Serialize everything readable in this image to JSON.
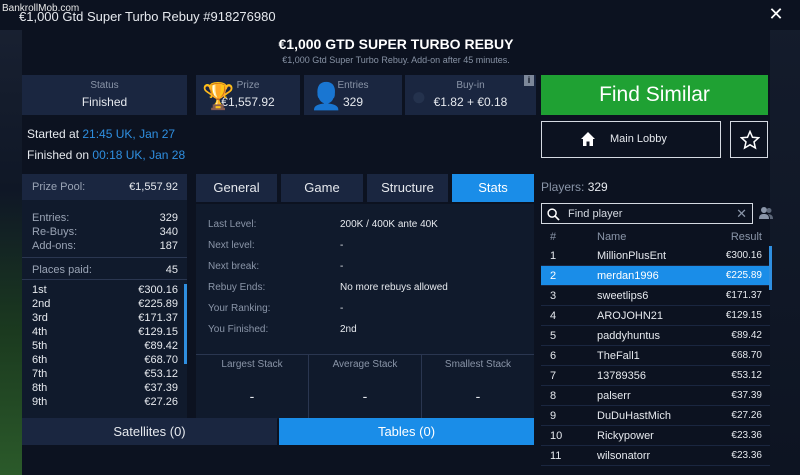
{
  "watermark": "BankrollMob.com",
  "window": {
    "title": "€1,000 Gtd Super Turbo Rebuy #918276980"
  },
  "header": {
    "title": "€1,000 GTD SUPER TURBO REBUY",
    "subtitle": "€1,000 Gtd Super Turbo Rebuy. Add-on after 45 minutes."
  },
  "info": {
    "status_label": "Status",
    "status_value": "Finished",
    "prize_label": "Prize",
    "prize_value": "€1,557.92",
    "entries_label": "Entries",
    "entries_value": "329",
    "buyin_label": "Buy-in",
    "buyin_value": "€1.82 + €0.18",
    "info_icon": "i"
  },
  "times": {
    "started_prefix": "Started at",
    "started_value": "21:45 UK, Jan 27",
    "finished_prefix": "Finished on",
    "finished_value": "00:18 UK, Jan 28"
  },
  "actions": {
    "find_similar": "Find Similar",
    "main_lobby": "Main Lobby"
  },
  "prize_panel": {
    "pool_label": "Prize Pool:",
    "pool_value": "€1,557.92",
    "entries_label": "Entries:",
    "entries_value": "329",
    "rebuys_label": "Re-Buys:",
    "rebuys_value": "340",
    "addons_label": "Add-ons:",
    "addons_value": "187",
    "places_label": "Places paid:",
    "places_value": "45",
    "places": [
      {
        "place": "1st",
        "amount": "€300.16"
      },
      {
        "place": "2nd",
        "amount": "€225.89"
      },
      {
        "place": "3rd",
        "amount": "€171.37"
      },
      {
        "place": "4th",
        "amount": "€129.15"
      },
      {
        "place": "5th",
        "amount": "€89.42"
      },
      {
        "place": "6th",
        "amount": "€68.70"
      },
      {
        "place": "7th",
        "amount": "€53.12"
      },
      {
        "place": "8th",
        "amount": "€37.39"
      },
      {
        "place": "9th",
        "amount": "€27.26"
      }
    ]
  },
  "tabs": [
    "General",
    "Game",
    "Structure",
    "Stats"
  ],
  "stats": {
    "rows": [
      {
        "label": "Last Level:",
        "value": "200K / 400K ante 40K"
      },
      {
        "label": "Next level:",
        "value": "-"
      },
      {
        "label": "Next break:",
        "value": "-"
      },
      {
        "label": "Rebuy Ends:",
        "value": "No more rebuys allowed"
      },
      {
        "label": "Your Ranking:",
        "value": "-"
      },
      {
        "label": "You Finished:",
        "value": "2nd"
      }
    ],
    "largest_label": "Largest Stack",
    "largest_value": "-",
    "average_label": "Average Stack",
    "average_value": "-",
    "smallest_label": "Smallest Stack",
    "smallest_value": "-"
  },
  "bottom_tabs": {
    "satellites": "Satellites (0)",
    "tables": "Tables (0)"
  },
  "players": {
    "label": "Players:",
    "count": "329",
    "search_placeholder": "Find player",
    "clear": "✕",
    "col_num": "#",
    "col_name": "Name",
    "col_result": "Result",
    "rows": [
      {
        "num": "1",
        "name": "MillionPlusEnt",
        "result": "€300.16"
      },
      {
        "num": "2",
        "name": "merdan1996",
        "result": "€225.89"
      },
      {
        "num": "3",
        "name": "sweetlips6",
        "result": "€171.37"
      },
      {
        "num": "4",
        "name": "AROJOHN21",
        "result": "€129.15"
      },
      {
        "num": "5",
        "name": "paddyhuntus",
        "result": "€89.42"
      },
      {
        "num": "6",
        "name": "TheFall1",
        "result": "€68.70"
      },
      {
        "num": "7",
        "name": "13789356",
        "result": "€53.12"
      },
      {
        "num": "8",
        "name": "palserr",
        "result": "€37.39"
      },
      {
        "num": "9",
        "name": "DuDuHastMich",
        "result": "€27.26"
      },
      {
        "num": "10",
        "name": "Rickypower",
        "result": "€23.36"
      },
      {
        "num": "11",
        "name": "wilsonatorr",
        "result": "€23.36"
      }
    ]
  },
  "colors": {
    "accent": "#1a8de8",
    "find_similar": "#1fa133",
    "link": "#2f8fe0"
  }
}
